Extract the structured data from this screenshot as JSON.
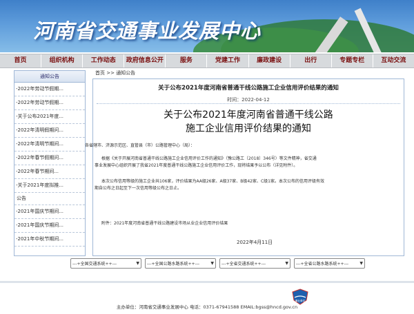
{
  "banner": {
    "title": "河南省交通事业发展中心"
  },
  "nav": [
    "首页",
    "组织机构",
    "工作动态",
    "政府信息公开",
    "服务",
    "党建工作",
    "廉政建设",
    "出行",
    "专题专栏",
    "互动交流"
  ],
  "sidebar": {
    "header": "通知公告",
    "items_top": [
      "-2022年劳动节假期...",
      "-2022年劳动节假期...",
      "-关于公布2021年度...",
      "-2022年清明假期问...",
      "-2022年清明节期间...",
      "-2022年春节假期问...",
      "-2022年春节期间...",
      "-关于2021年度拟推..."
    ],
    "section_label": "公告",
    "items_bottom": [
      "-2021年国庆节期间...",
      "-2021年国庆节期间...",
      "-2021年中秋节期间..."
    ]
  },
  "breadcrumb": {
    "home": "首页",
    "sep": " >> ",
    "current": "通知公告"
  },
  "article": {
    "title": "关于公布2021年度河南省普通干线公路施工企业信用评价结果的通知",
    "date_label": "时间：",
    "date": "2022-04-12",
    "headline_line1": "关于公布2021年度河南省普通干线公路",
    "headline_line2": "施工企业信用评价结果的通知",
    "salutation": "各省辖市、济源示范区、直管县（市）公路管理中心（局）：",
    "para1_line1": "根据《关于开展河南省普通干线公路施工企业信用评价工作的通知》（豫公路工〔2018〕346号）等文件精神，省交通",
    "para1_line2": "事业发展中心组织开展了我省2021年度普通干线公路施工企业信用评价工作，现将结果予以公布（详见附件）。",
    "para2_line1": "本次公布信用等级的施工企业共106家，评价结果为AA级26家、A级37家、B级42家、C级1家。本次公布的信用评级有效",
    "para2_line2": "期自公布之日起至下一次信用等级公布之日止。",
    "attachment": "附件：2021年度河南省普通干线公路建设市场从业企业信用评价结果",
    "sign_date": "2022年4月11日"
  },
  "selects": [
    "---+全国交通系统++---",
    "---+全国公路水路系统++---",
    "---+全省交通系统++---",
    "---+全省公路水路系统++---"
  ],
  "footer": {
    "text": "主办单位：河南省交通事业发展中心 电话：0371-67941588 EMAIL:bgss@hncd.gov.cn",
    "logo_text": "事业单位"
  }
}
